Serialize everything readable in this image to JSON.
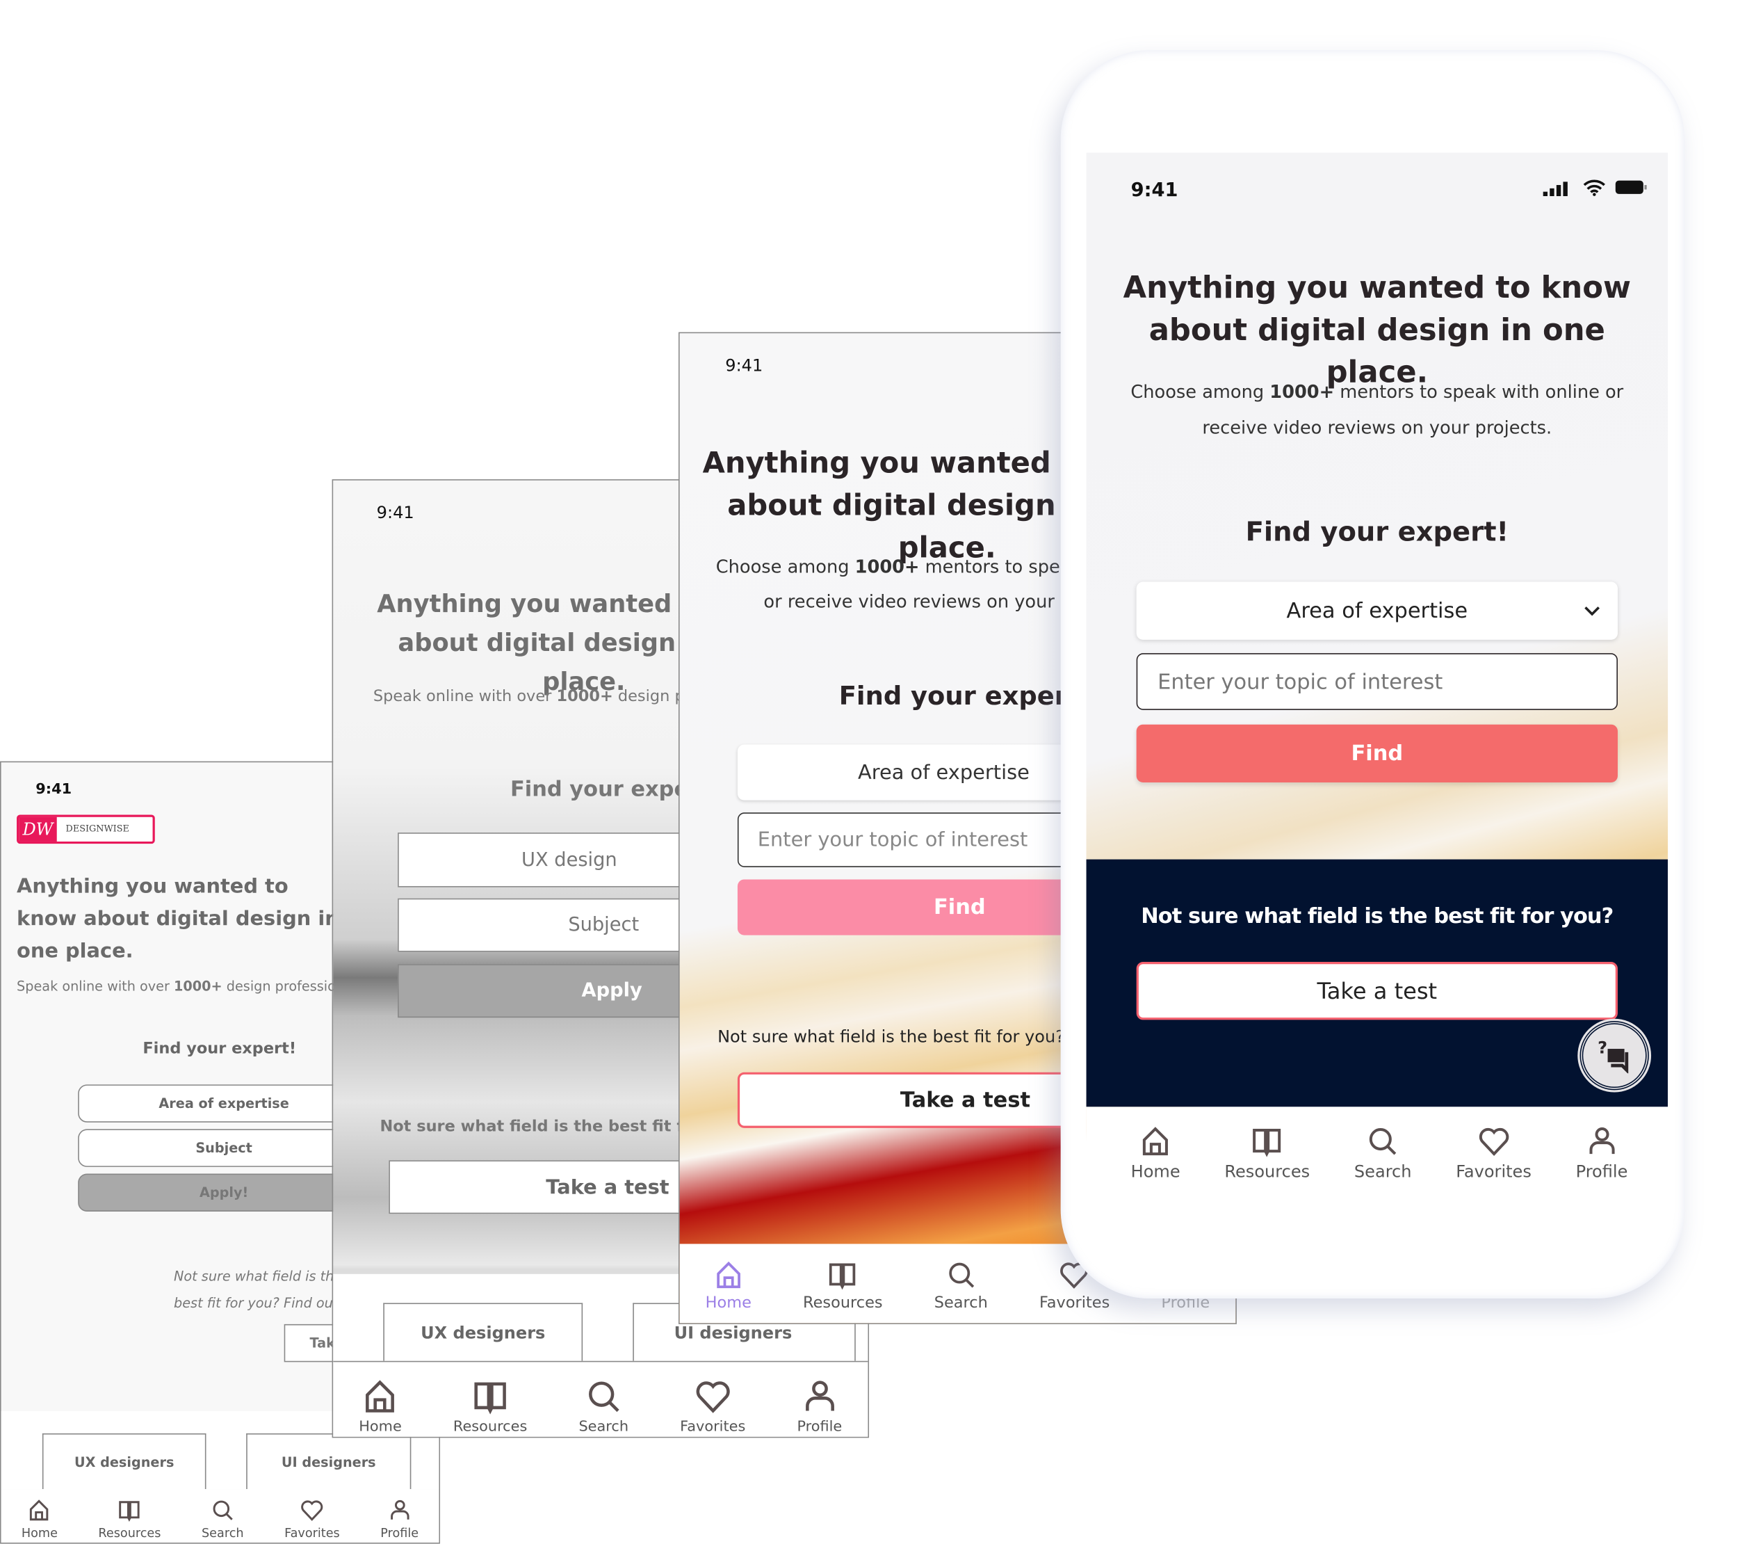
{
  "status_time": "9:41",
  "screen1": {
    "logo_mark": "DW",
    "logo_text": "DESIGNWISE",
    "headline": "Anything you wanted to know about digital design in one place.",
    "sub_pre": "Speak online with over ",
    "sub_bold": "1000+",
    "sub_post": " design professionals",
    "find_title": "Find your expert!",
    "area": "Area of expertise",
    "subject": "Subject",
    "apply": "Apply!",
    "not_sure": "Not sure what field is the best fit for you? Find out!",
    "take": "Take a test",
    "cards": [
      "UX designers",
      "UI designers"
    ],
    "nav": [
      "Home",
      "Resources",
      "Search",
      "Favorites",
      "Profile"
    ]
  },
  "screen2": {
    "headline": "Anything you wanted to know about digital design in one place.",
    "sub_pre": "Speak online with over ",
    "sub_bold": "1000+",
    "sub_post": " design professionals",
    "find_title": "Find your expert!",
    "area": "UX design",
    "subject": "Subject",
    "apply": "Apply",
    "not_sure": "Not sure what field is the best fit for you?",
    "take": "Take a test",
    "cards": [
      "UX designers",
      "UI designers"
    ],
    "nav": [
      "Home",
      "Resources",
      "Search",
      "Favorites",
      "Profile"
    ]
  },
  "screen3": {
    "headline": "Anything you wanted to know about digital design in one place.",
    "sub_pre": "Choose among ",
    "sub_bold": "1000+",
    "sub_post": " mentors to speak with online or receive video reviews on your projects.",
    "find_title": "Find your expert!",
    "area": "Area of expertise",
    "placeholder": "Enter your topic of interest",
    "find": "Find",
    "not_sure": "Not sure what field is the best fit for you?",
    "take": "Take a test",
    "nav": [
      "Home",
      "Resources",
      "Search",
      "Favorites",
      "Profile"
    ],
    "active_color": "#9b7fe6",
    "find_color": "#fb8ca6"
  },
  "phone": {
    "headline": "Anything you wanted to know about digital design in one place.",
    "sub_pre": "Choose among ",
    "sub_bold": "1000+",
    "sub_post": " mentors to speak with online or receive video reviews on your projects.",
    "find_title": "Find your expert!",
    "area": "Area of expertise",
    "placeholder": "Enter your topic of interest",
    "find": "Find",
    "not_sure": "Not sure what field is the best fit for you?",
    "take": "Take a test",
    "nav": [
      "Home",
      "Resources",
      "Search",
      "Favorites",
      "Profile"
    ],
    "find_color": "#f46b6b",
    "navy": "#021230",
    "accent_border": "#f4606e"
  }
}
